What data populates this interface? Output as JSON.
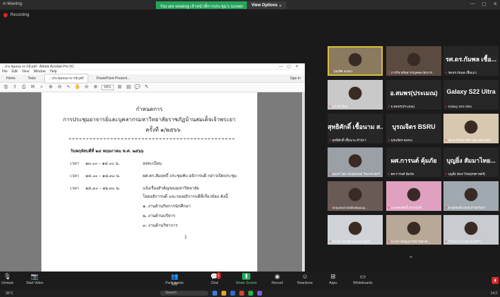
{
  "app": {
    "title": "m Meeting",
    "recording": "Recording"
  },
  "banner": {
    "message": "You are viewing เจ้าหน้าที่การประชุม's screen",
    "options": "View Options"
  },
  "acrobat": {
    "window_title": "...ประชุมคณาจารย์.pdf - Adobe Acrobat Pro DC",
    "menu": [
      "File",
      "Edit",
      "View",
      "Window",
      "Help"
    ],
    "tabs": [
      "Home",
      "Tools",
      "...ประชุมคณาจารย์.pdf",
      "PowerPoint Present..."
    ],
    "sign_in": "Sign In",
    "zoom": "88%"
  },
  "document": {
    "title1": "กำหนดการ",
    "title2": "การประชุมอาจารย์และบุคลากรมหาวิทยาลัยราชภัฏบ้านสมเด็จเจ้าพระยา",
    "title3": "ครั้งที่ ๑/๒๕๖๖",
    "date": "วันพฤหัสบดีที่ ๒๔ พฤษภาคม พ.ศ. ๒๕๖๖",
    "schedule": [
      {
        "label": "เวลา",
        "time": "๑๓.๐๐ – ๑๔.๐๐ น.",
        "desc": "ลงทะเบียน"
      },
      {
        "label": "เวลา",
        "time": "๑๔.๐๐ – ๑๔.๓๐ น.",
        "desc": "ผศ.ดร.สัมฤทธิ์ ประชุมทับ อธิการบดี กล่าวเปิดประชุม"
      },
      {
        "label": "เวลา",
        "time": "๑๔.๓๐ – ๑๖.๓๐ น.",
        "desc": "แจ้งเรื่องสำคัญของมหาวิทยาลัย"
      }
    ],
    "desc_more": "โดยอธิการบดี และรองอธิการบดีที่เกี่ยวข้อง ดังนี้",
    "items": [
      "๑. งานด้านกิจการนักศึกษา",
      "๒. งานด้านบริหาร",
      "๓. งานด้านวิชาการ"
    ]
  },
  "gallery": [
    {
      "name": "",
      "label": "บัณฑิต BSRU",
      "video": true,
      "color": "#8a7a60",
      "active": true
    },
    {
      "name": "",
      "label": "ภารกิจ ทรัพยากรบุคคล-นักการ...",
      "video": true,
      "color": "#5a4a40"
    },
    {
      "name": "รศ.ดร.กัมพล เชื้อ...",
      "label": "รศ.ดร.กัมพล เชื้อแถว",
      "video": false
    },
    {
      "name": "",
      "label": "แก้วตาห์นล",
      "video": true,
      "color": "#c9c9c9"
    },
    {
      "name": "อ.สมพร(ประเมณ)",
      "label": "อ.สมพร(ประเมณ)",
      "video": false
    },
    {
      "name": "Galaxy S22 Ultra",
      "label": "Galaxy S22 Ultra",
      "video": false
    },
    {
      "name": "สุทธิศักดิ์ เชื้อนาม ส...",
      "label": "สุทธิศักดิ์ เชื้อนาม สำนักฯ",
      "video": false
    },
    {
      "name": "บุรณจิตร BSRU",
      "label": "บุรณจิตร BSRU",
      "video": false
    },
    {
      "name": "",
      "label": "ผศ.อารีรัตน์ ปรีชาบุญ ครุศาสตร์",
      "video": true,
      "color": "#d8c8b0"
    },
    {
      "name": "",
      "label": "สุนทร โสดามั่นสัมพันธ์ วิทยาศาสตร์",
      "video": true,
      "color": "#9aa0a6"
    },
    {
      "name": "ผศ.การนต์ คุ้มภัย",
      "label": "ผศ.การนต์ คุ้มภัย",
      "video": false
    },
    {
      "name": "บุญยิ่ง สัมมาไทย...",
      "label": "บุญยิ่ง สัมมาไทย(ครุศาสตร์)",
      "video": false
    },
    {
      "name": "",
      "label": "Ornpimol Kittikhetkasup...",
      "video": true,
      "color": "#6a5a55"
    },
    {
      "name": "",
      "label": "นายทรงศักดิ์ เจ้าหน้าที่...",
      "video": true,
      "color": "#e0a0c0"
    },
    {
      "name": "",
      "label": "ฝ่ายคอมพิวเตอร์ สำนักวิทยฯ",
      "video": true,
      "color": "#a0a8b0"
    },
    {
      "name": "",
      "label": "นางสาวจารุณี ทองแสง ศูนย์...",
      "video": true,
      "color": "#d0d4d8"
    },
    {
      "name": "",
      "label": "นางสาวสัญญาภรณ์ วิทยาศ...",
      "video": true,
      "color": "#b8a898"
    },
    {
      "name": "",
      "label": "วิโรจน์ แก้ววงษ์ ศาสตร์ฯ",
      "video": true,
      "color": "#c8ccd0"
    }
  ],
  "toolbar": {
    "mute": "Unmute",
    "video": "Start Video",
    "participants": "Participants",
    "participants_count": "625",
    "chat": "Chat",
    "chat_badge": "1",
    "share": "Share Screen",
    "record": "Record",
    "reactions": "Reactions",
    "apps": "Apps",
    "whiteboards": "Whiteboards"
  },
  "taskbar": {
    "temp": "36°C",
    "search": "Search",
    "clock": "14:2"
  }
}
